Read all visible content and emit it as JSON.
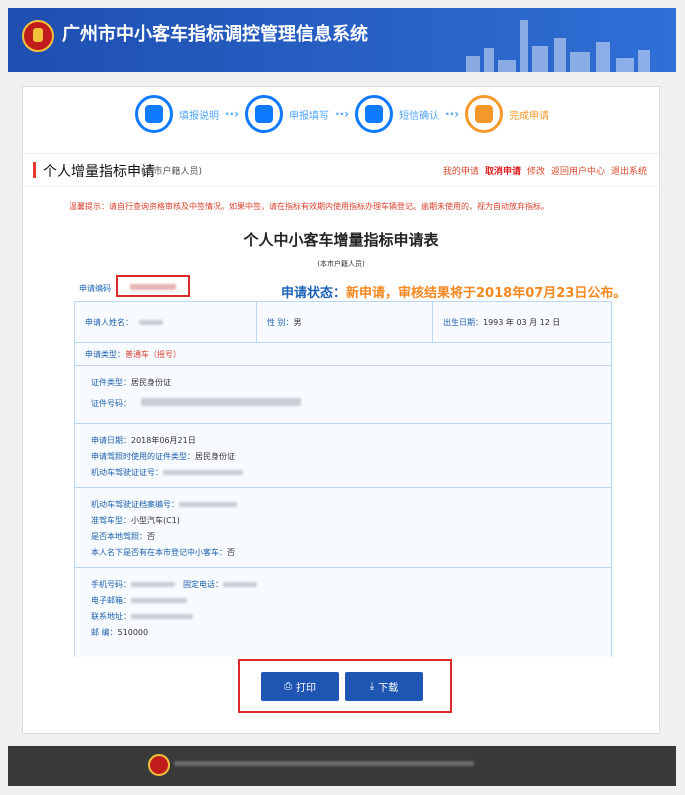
{
  "header": {
    "title": "广州市中小客车指标调控管理信息系统"
  },
  "steps": [
    {
      "label": "填报说明",
      "icon": "list-icon",
      "state": "active"
    },
    {
      "label": "申报填写",
      "icon": "edit-icon",
      "state": "active"
    },
    {
      "label": "短信确认",
      "icon": "phone-icon",
      "state": "active"
    },
    {
      "label": "完成申请",
      "icon": "done-icon",
      "state": "done"
    }
  ],
  "section": {
    "title": "个人增量指标申请",
    "subtitle": "(本市户籍人员)",
    "links": [
      "我的申请",
      "取消申请",
      "修改",
      "返回用户中心",
      "退出系统"
    ]
  },
  "tip": "温馨提示：请自行查询资格审核及中签情况。如果中签，请在指标有效期内使用指标办理车辆登记。逾期未使用的，视为自动放弃指标。",
  "form": {
    "title": "个人中小客车增量指标申请表",
    "subtitle": "(本市户籍人员)",
    "app_no_label": "申请编码",
    "status_label": "申请状态：",
    "status_value": "新申请，审核结果将于2018年07月23日公布。"
  },
  "fields": {
    "name_label": "申请人姓名：",
    "gender_label": "性 别：",
    "gender_value": "男",
    "birth_label": "出生日期：",
    "birth_value": "1993 年 03 月 12 日",
    "apply_type_label": "申请类型：",
    "apply_type_value": "普通车（摇号）",
    "id_type_label": "证件类型：",
    "id_type_value": "居民身份证",
    "id_no_label": "证件号码：",
    "apply_date_label": "申请日期：",
    "apply_date_value": "2018年06月21日",
    "license_id_type_label": "申请驾照时使用的证件类型：",
    "license_id_type_value": "居民身份证",
    "license_no_label": "机动车驾驶证证号：",
    "archive_no_label": "机动车驾驶证档案编号：",
    "vehicle_type_label": "准驾车型：",
    "vehicle_type_value": "小型汽车(C1)",
    "local_license_label": "是否本地驾照：",
    "local_license_value": "否",
    "has_car_label": "本人名下是否有在本市登记中小客车：",
    "has_car_value": "否",
    "mobile_label": "手机号码：",
    "phone_label": "固定电话：",
    "email_label": "电子邮箱：",
    "address_label": "联系地址：",
    "postcode_label": "邮  编：",
    "postcode_value": "510000"
  },
  "buttons": {
    "print": "打印",
    "download": "下载"
  }
}
